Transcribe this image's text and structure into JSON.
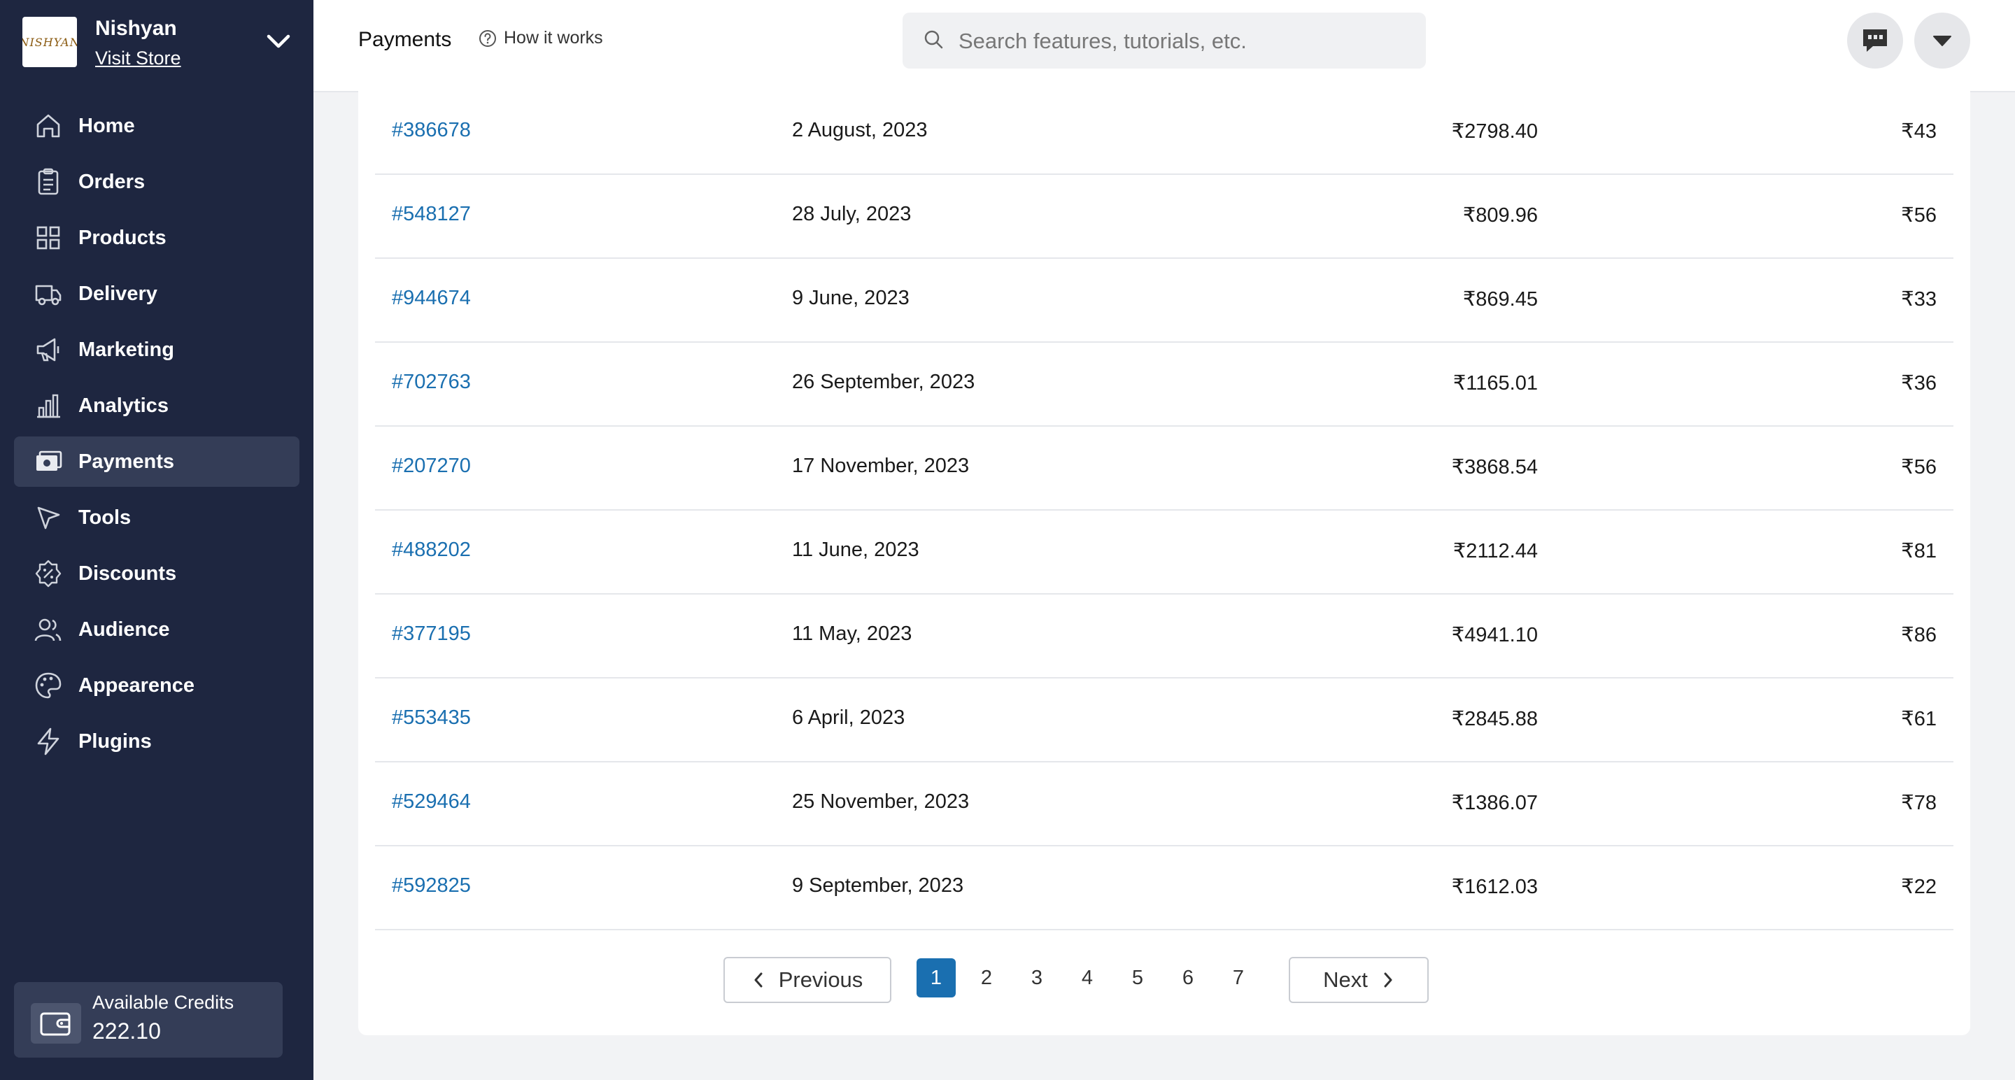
{
  "store": {
    "name": "Nishyan",
    "visit_label": "Visit Store",
    "logo_text": "NISHYAN"
  },
  "nav": [
    {
      "label": "Home",
      "icon": "home-icon",
      "active": false
    },
    {
      "label": "Orders",
      "icon": "orders-icon",
      "active": false
    },
    {
      "label": "Products",
      "icon": "products-icon",
      "active": false
    },
    {
      "label": "Delivery",
      "icon": "truck-icon",
      "active": false
    },
    {
      "label": "Marketing",
      "icon": "megaphone-icon",
      "active": false
    },
    {
      "label": "Analytics",
      "icon": "bar-chart-icon",
      "active": false
    },
    {
      "label": "Payments",
      "icon": "payments-icon",
      "active": true
    },
    {
      "label": "Tools",
      "icon": "cursor-icon",
      "active": false
    },
    {
      "label": "Discounts",
      "icon": "discount-badge-icon",
      "active": false
    },
    {
      "label": "Audience",
      "icon": "users-icon",
      "active": false
    },
    {
      "label": "Appearence",
      "icon": "palette-icon",
      "active": false
    },
    {
      "label": "Plugins",
      "icon": "lightning-icon",
      "active": false
    }
  ],
  "credits": {
    "label": "Available Credits",
    "value": "222.10"
  },
  "header": {
    "title": "Payments",
    "how_it_works": "How it works",
    "search_placeholder": "Search features, tutorials, etc."
  },
  "payments": [
    {
      "id": "#386678",
      "date": "2 August, 2023",
      "amount": "₹2798.40",
      "fee": "₹43"
    },
    {
      "id": "#548127",
      "date": "28 July, 2023",
      "amount": "₹809.96",
      "fee": "₹56"
    },
    {
      "id": "#944674",
      "date": "9 June, 2023",
      "amount": "₹869.45",
      "fee": "₹33"
    },
    {
      "id": "#702763",
      "date": "26 September, 2023",
      "amount": "₹1165.01",
      "fee": "₹36"
    },
    {
      "id": "#207270",
      "date": "17 November, 2023",
      "amount": "₹3868.54",
      "fee": "₹56"
    },
    {
      "id": "#488202",
      "date": "11 June, 2023",
      "amount": "₹2112.44",
      "fee": "₹81"
    },
    {
      "id": "#377195",
      "date": "11 May, 2023",
      "amount": "₹4941.10",
      "fee": "₹86"
    },
    {
      "id": "#553435",
      "date": "6 April, 2023",
      "amount": "₹2845.88",
      "fee": "₹61"
    },
    {
      "id": "#529464",
      "date": "25 November, 2023",
      "amount": "₹1386.07",
      "fee": "₹78"
    },
    {
      "id": "#592825",
      "date": "9 September, 2023",
      "amount": "₹1612.03",
      "fee": "₹22"
    }
  ],
  "pagination": {
    "previous_label": "Previous",
    "next_label": "Next",
    "pages": [
      "1",
      "2",
      "3",
      "4",
      "5",
      "6",
      "7"
    ],
    "current": "1"
  },
  "colors": {
    "sidebar_bg": "#1e2640",
    "active_nav": "#343d57",
    "link": "#1a6fb0"
  }
}
